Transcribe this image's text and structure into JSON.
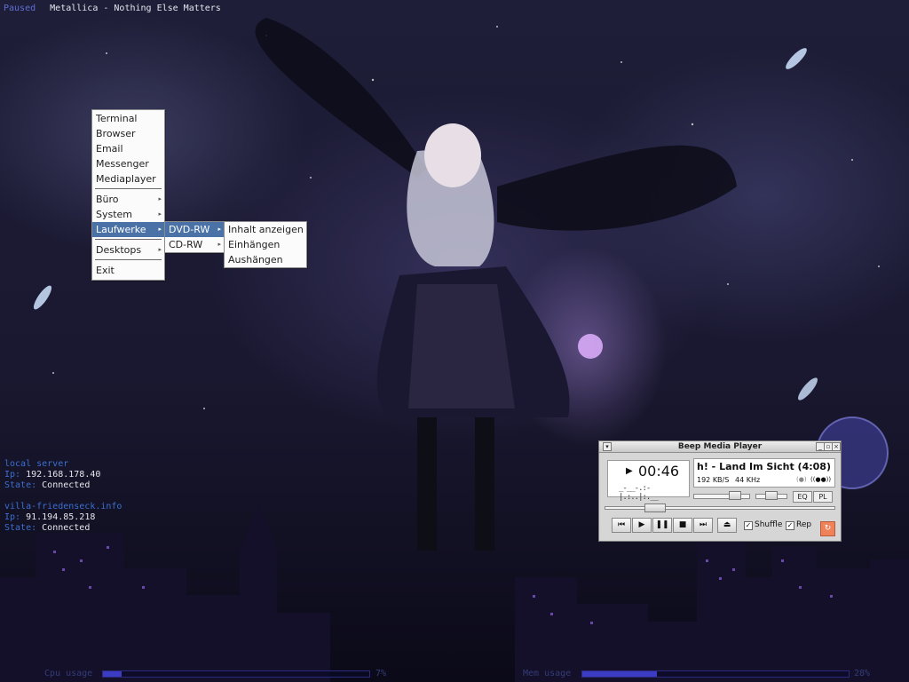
{
  "overlay": {
    "status": "Paused",
    "track": "Metallica - Nothing Else Matters",
    "connections": [
      {
        "host": "local server",
        "ip_label": "Ip:",
        "ip": "192.168.178.40",
        "state_label": "State:",
        "state": "Connected"
      },
      {
        "host": "villa-friedenseck.info",
        "ip_label": "Ip:",
        "ip": "91.194.85.218",
        "state_label": "State:",
        "state": "Connected"
      }
    ],
    "cpu": {
      "label": "Cpu usage",
      "value": "7%",
      "fraction": 0.07
    },
    "mem": {
      "label": "Mem usage",
      "value": "28%",
      "fraction": 0.28
    }
  },
  "menu": {
    "items": [
      "Terminal",
      "Browser",
      "Email",
      "Messenger",
      "Mediaplayer"
    ],
    "groups": [
      "Büro",
      "System",
      "Laufwerke",
      "Desktops"
    ],
    "exit": "Exit",
    "active": "Laufwerke"
  },
  "drives_menu": {
    "items": [
      "DVD-RW",
      "CD-RW"
    ],
    "active": "DVD-RW"
  },
  "dvd_menu": {
    "items": [
      "Inhalt anzeigen",
      "Einhängen",
      "Aushängen"
    ]
  },
  "player": {
    "title": "Beep Media Player",
    "time": "00:46",
    "song": "h! - Land Im Sicht (4:08)",
    "bitrate": "192 KB/S",
    "frequency": "44 KHz",
    "mono": "(●)",
    "stereo": "((●●))",
    "eq_label": "EQ",
    "pl_label": "PL",
    "shuffle_label": "Shuffle",
    "shuffle_checked": true,
    "repeat_label": "Rep",
    "repeat_checked": true,
    "volume": 0.8,
    "balance": 0.5,
    "position": 0.19
  },
  "icons": {
    "arrow": "▸",
    "prev": "⏮",
    "play": "▶",
    "pause": "❚❚",
    "stop": "■",
    "next": "⏭",
    "eject": "⏏",
    "close": "×",
    "minimize": "_",
    "shade": "▫",
    "menu": "▾",
    "check": "✓",
    "refresh": "↻"
  }
}
